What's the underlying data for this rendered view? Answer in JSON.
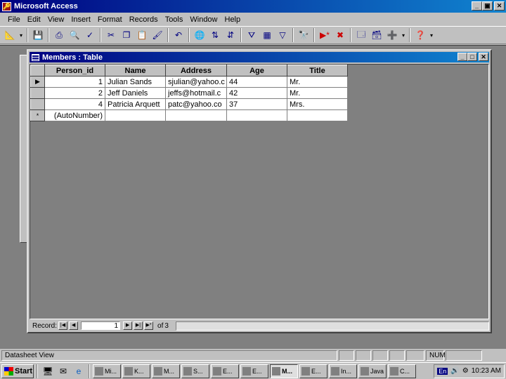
{
  "app": {
    "title": "Microsoft Access",
    "caption_min": "_",
    "caption_restore": "▣",
    "caption_close": "✕"
  },
  "menu": [
    "File",
    "Edit",
    "View",
    "Insert",
    "Format",
    "Records",
    "Tools",
    "Window",
    "Help"
  ],
  "toolbar": {
    "icons": [
      "design-view-icon",
      "save-icon",
      "print-icon",
      "print-preview-icon",
      "spelling-icon",
      "cut-icon",
      "copy-icon",
      "paste-icon",
      "format-painter-icon",
      "undo-icon",
      "hyperlink-icon",
      "sort-ascending-icon",
      "sort-descending-icon",
      "filter-by-selection-icon",
      "filter-by-form-icon",
      "apply-filter-icon",
      "find-icon",
      "new-record-icon",
      "delete-record-icon",
      "properties-icon",
      "database-window-icon",
      "new-object-icon",
      "help-icon"
    ]
  },
  "table_window": {
    "title": "Members : Table",
    "columns": [
      "Person_id",
      "Name",
      "Address",
      "Age",
      "Title"
    ],
    "rows": [
      {
        "selector": "▶",
        "Person_id": "1",
        "Name": "Julian Sands",
        "Address": "sjulian@yahoo.c",
        "Age": "44",
        "Title": "Mr."
      },
      {
        "selector": "",
        "Person_id": "2",
        "Name": "Jeff Daniels",
        "Address": "jeffs@hotmail.c",
        "Age": "42",
        "Title": "Mr."
      },
      {
        "selector": "",
        "Person_id": "4",
        "Name": "Patricia Arquett",
        "Address": "patc@yahoo.co",
        "Age": "37",
        "Title": "Mrs."
      }
    ],
    "new_row": {
      "selector": "*",
      "Person_id": "(AutoNumber)"
    },
    "navigator": {
      "label": "Record:",
      "first": "|◀",
      "prev": "◀",
      "current": "1",
      "next": "▶",
      "last": "▶|",
      "new": "▶*",
      "of_text": "of",
      "total": "3"
    }
  },
  "status_bar": {
    "text": "Datasheet View",
    "num": "NUM"
  },
  "taskbar": {
    "start": "Start",
    "tasks": [
      "Mi...",
      "K...",
      "M...",
      "S...",
      "E...",
      "E...",
      "M...",
      "E...",
      "In...",
      "Java",
      "C..."
    ],
    "active_index": 6,
    "tray": {
      "lang": "En",
      "time": "10:23 AM"
    }
  }
}
